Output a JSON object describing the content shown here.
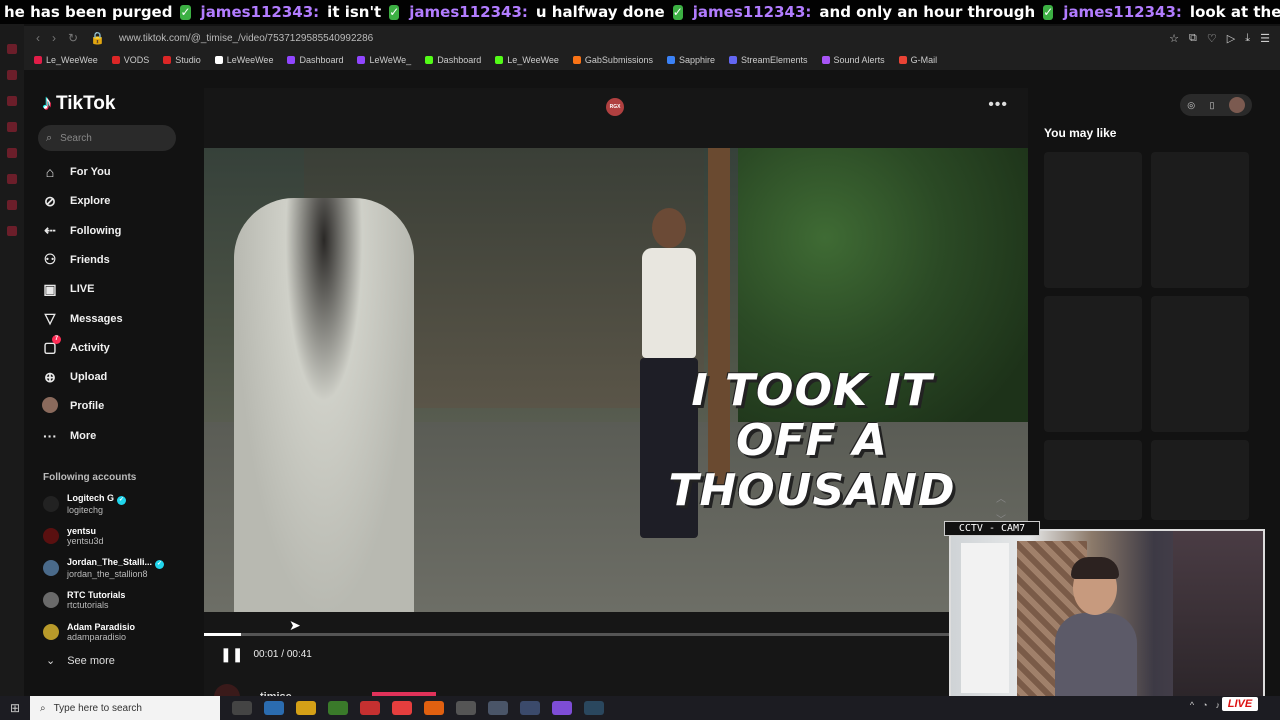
{
  "chat": {
    "messages": [
      {
        "user": "",
        "text": "he has been purged"
      },
      {
        "user": "james112343:",
        "text": "it isn't"
      },
      {
        "user": "james112343:",
        "text": "u halfway done"
      },
      {
        "user": "james112343:",
        "text": "and only an hour through"
      },
      {
        "user": "james112343:",
        "text": "look at the second slide"
      }
    ]
  },
  "browser": {
    "url": "www.tiktok.com/@_timise_/video/7537129585540992286",
    "bookmarks": [
      {
        "label": "Le_WeeWee",
        "color": "#e11d48"
      },
      {
        "label": "VODS",
        "color": "#dc2626"
      },
      {
        "label": "Studio",
        "color": "#dc2626"
      },
      {
        "label": "LeWeeWee",
        "color": "#ffffff"
      },
      {
        "label": "Dashboard",
        "color": "#9146ff"
      },
      {
        "label": "LeWeWe_",
        "color": "#9146ff"
      },
      {
        "label": "Dashboard",
        "color": "#53fc18"
      },
      {
        "label": "Le_WeeWee",
        "color": "#53fc18"
      },
      {
        "label": "GabSubmissions",
        "color": "#f97316"
      },
      {
        "label": "Sapphire",
        "color": "#3b82f6"
      },
      {
        "label": "StreamElements",
        "color": "#6366f1"
      },
      {
        "label": "Sound Alerts",
        "color": "#a855f7"
      },
      {
        "label": "G-Mail",
        "color": "#ea4335"
      }
    ]
  },
  "sidebar": {
    "brand": "TikTok",
    "search_placeholder": "Search",
    "nav": [
      {
        "label": "For You",
        "icon": "home-icon"
      },
      {
        "label": "Explore",
        "icon": "compass-icon"
      },
      {
        "label": "Following",
        "icon": "user-follow-icon"
      },
      {
        "label": "Friends",
        "icon": "friends-icon"
      },
      {
        "label": "LIVE",
        "icon": "live-icon"
      },
      {
        "label": "Messages",
        "icon": "messages-icon"
      },
      {
        "label": "Activity",
        "icon": "activity-icon",
        "badge": "7"
      },
      {
        "label": "Upload",
        "icon": "upload-icon"
      },
      {
        "label": "Profile",
        "icon": "profile-avatar"
      },
      {
        "label": "More",
        "icon": "more-icon"
      }
    ],
    "following_title": "Following accounts",
    "accounts": [
      {
        "name": "Logitech G",
        "handle": "logitechg",
        "verified": true,
        "color": "#222"
      },
      {
        "name": "yentsu",
        "handle": "yentsu3d",
        "verified": false,
        "color": "#5a1010"
      },
      {
        "name": "Jordan_The_Stalli...",
        "handle": "jordan_the_stallion8",
        "verified": true,
        "color": "#4a6a8a"
      },
      {
        "name": "RTC Tutorials",
        "handle": "rtctutorials",
        "verified": false,
        "color": "#6a6a6a"
      },
      {
        "name": "Adam Paradisio",
        "handle": "adamparadisio",
        "verified": false,
        "color": "#b89a2a"
      }
    ],
    "see_more": "See more"
  },
  "video": {
    "channel_badge": "RGX",
    "caption_lines": [
      "I TOOK IT",
      "OFF A",
      "THOUSAND"
    ],
    "time": "00:01 / 00:41",
    "progress": 0.05,
    "author": "timise"
  },
  "right": {
    "title": "You may like"
  },
  "webcam": {
    "label": "CCTV - CAM7",
    "live": "LIVE"
  },
  "taskbar": {
    "search_placeholder": "Type here to search"
  }
}
